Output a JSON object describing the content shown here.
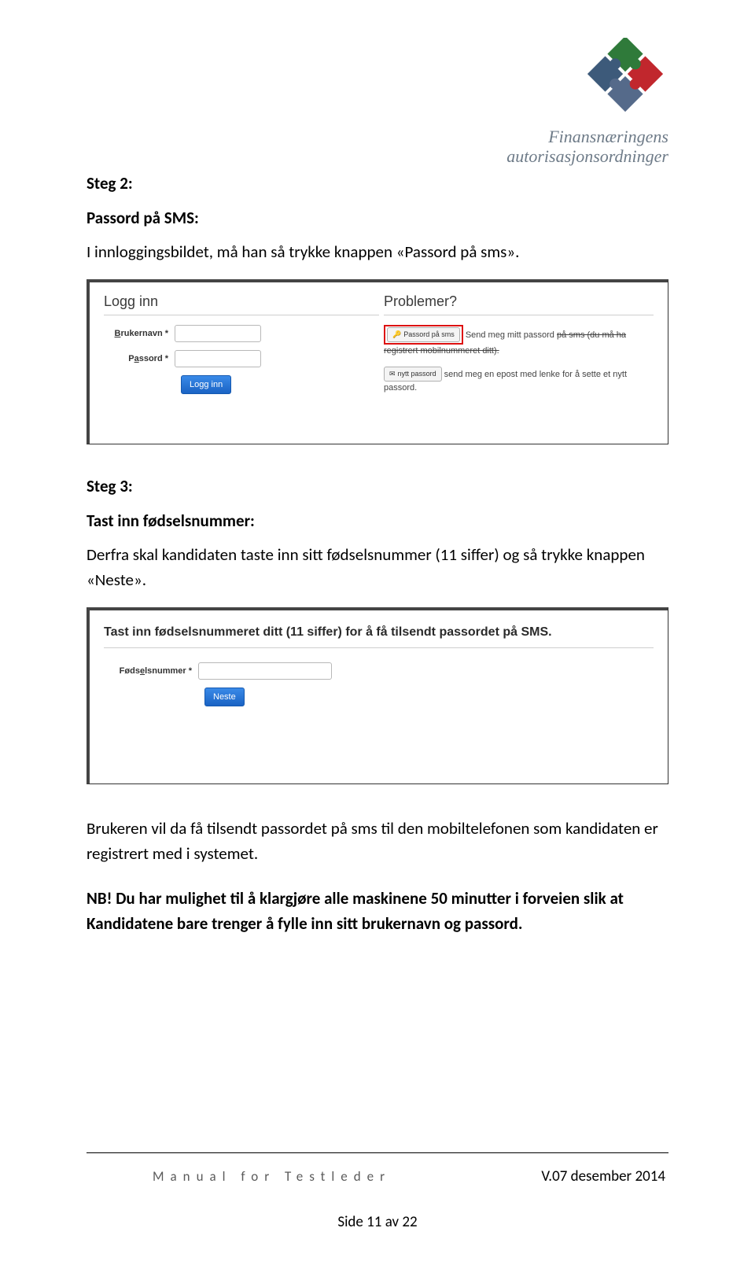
{
  "logo": {
    "line1": "Finansnæringens",
    "line2": "autorisasjonsordninger"
  },
  "step2": {
    "heading": "Steg 2:",
    "sub": "Passord på SMS:",
    "text": "I innloggingsbildet, må han så trykke knappen «Passord på sms»."
  },
  "panel1": {
    "leftTitle": "Logg inn",
    "rightTitle": "Problemer?",
    "userLabelPrefix": "B",
    "userLabelRest": "rukernavn *",
    "passLabelPrefix": "a",
    "passLabelPre": "P",
    "passLabelRest": "ssord *",
    "loginBtn": "Logg inn",
    "smsBtnIcon": "🔑",
    "smsBtn": "Passord på sms",
    "smsHelp1": "Send meg mitt passord",
    "smsHelp2": "på sms (du må ha registrert mobilnummeret ditt).",
    "newBtnIcon": "✉",
    "newBtn": "nytt passord",
    "newHelp": "send meg en epost med lenke for å sette et nytt passord."
  },
  "step3": {
    "heading": "Steg 3:",
    "sub": "Tast inn fødselsnummer:",
    "text": "Derfra skal kandidaten taste inn sitt fødselsnummer (11 siffer) og så trykke knappen «Neste»."
  },
  "panel2": {
    "heading": "Tast inn fødselsnummeret ditt (11 siffer) for å få tilsendt passordet på SMS.",
    "fieldLabelPre": "Føds",
    "fieldLabelU": "e",
    "fieldLabelRest": "lsnummer *",
    "btn": "Neste"
  },
  "after": {
    "p1": "Brukeren vil da få tilsendt passordet på sms til den mobiltelefonen som kandidaten er registrert med i systemet.",
    "nb": "NB! Du har mulighet til å klargjøre alle maskinene 50 minutter i forveien slik at Kandidatene bare trenger å fylle inn sitt brukernavn og passord."
  },
  "footer": {
    "left": "Manual for Testleder",
    "right": "V.07 desember 2014",
    "pageNum": "Side 11 av 22"
  }
}
